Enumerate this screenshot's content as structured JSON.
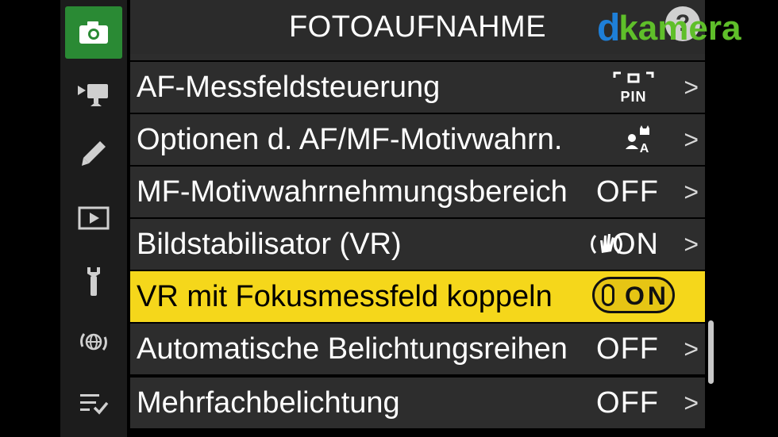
{
  "header": {
    "title": "FOTOAUFNAHME",
    "help": "?"
  },
  "watermark": {
    "d": "d",
    "rest": "kamera",
    "colors": {
      "d": "#1e7fd8",
      "rest": "#5fbf2a"
    }
  },
  "sidebar": {
    "items": [
      {
        "icon": "camera-icon",
        "active": true
      },
      {
        "icon": "video-camera-icon",
        "active": false
      },
      {
        "icon": "pencil-icon",
        "active": false
      },
      {
        "icon": "playback-icon",
        "active": false
      },
      {
        "icon": "wrench-icon",
        "active": false
      },
      {
        "icon": "network-icon",
        "active": false
      },
      {
        "icon": "my-menu-icon",
        "active": false
      }
    ]
  },
  "menu": {
    "rows": [
      {
        "label": "AF-Messfeldsteuerung",
        "value": "PIN",
        "value_icon": "af-area-pin-icon",
        "chevron": ">"
      },
      {
        "label": "Optionen d. AF/MF-Motivwahrn.",
        "value": "A",
        "value_icon": "subject-detection-auto-icon",
        "chevron": ">"
      },
      {
        "label": "MF-Motivwahrnehmungsbereich",
        "value": "OFF",
        "chevron": ">"
      },
      {
        "label": "Bildstabilisator (VR)",
        "value": "ON",
        "value_icon": "vr-hand-icon",
        "chevron": ">"
      },
      {
        "label": "VR mit Fokusmessfeld koppeln",
        "value": "ON",
        "selected": true
      },
      {
        "label": "Automatische Belichtungsreihen",
        "value": "OFF",
        "chevron": ">"
      },
      {
        "label": "Mehrfachbelichtung",
        "value": "OFF",
        "chevron": ">"
      }
    ]
  },
  "colors": {
    "selected_row": "#f5d71b",
    "active_tab": "#2a8a34",
    "row_bg": "#2d2d2d"
  }
}
